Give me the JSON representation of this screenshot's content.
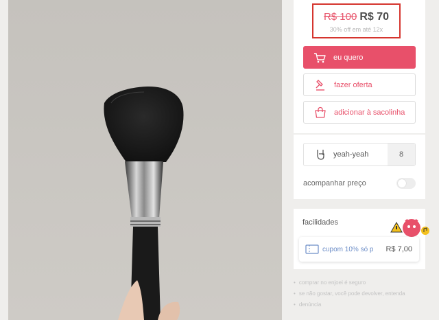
{
  "pricing": {
    "old_price": "R$ 100",
    "new_price": "R$ 70",
    "installments": "30% off em até 12x"
  },
  "actions": {
    "buy_label": "eu quero",
    "offer_label": "fazer oferta",
    "bag_label": "adicionar à sacolinha"
  },
  "social": {
    "likes_label": "yeah-yeah",
    "likes_count": "8",
    "track_price_label": "acompanhar preço",
    "track_price_enabled": false
  },
  "facilities": {
    "title": "facilidades",
    "coupon_text": "cupom 10% só p",
    "coupon_amount": "R$ 7,00"
  },
  "notes": [
    "comprar no enjoei é seguro",
    "se não gostar, você pode devolver, entenda",
    "denúncia"
  ],
  "colors": {
    "accent": "#e8506a",
    "highlight_border": "#d5352e",
    "coupon_text": "#6c8dc7"
  },
  "icons": {
    "buy": "cart-icon",
    "offer": "gavel-icon",
    "bag": "shopping-bag-icon",
    "likes": "rock-hand-icon",
    "coupon": "ticket-icon"
  }
}
